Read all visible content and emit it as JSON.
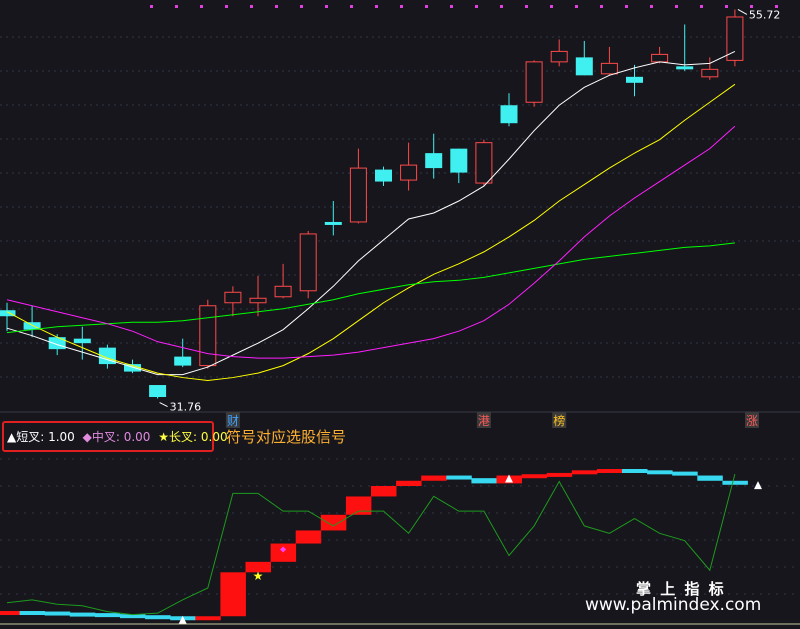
{
  "chart_data": [
    {
      "type": "candlestick",
      "title": "",
      "price_labels": {
        "high": "55.72",
        "low": "31.76"
      },
      "candles": [
        {
          "o": 37.7,
          "c": 37.3,
          "h": 38.2,
          "l": 36.3
        },
        {
          "o": 36.9,
          "c": 36.4,
          "h": 38.0,
          "l": 35.9
        },
        {
          "o": 35.9,
          "c": 35.1,
          "h": 36.1,
          "l": 34.7
        },
        {
          "o": 35.8,
          "c": 35.5,
          "h": 36.6,
          "l": 34.4
        },
        {
          "o": 35.2,
          "c": 34.1,
          "h": 35.4,
          "l": 33.8
        },
        {
          "o": 34.1,
          "c": 33.6,
          "h": 34.4,
          "l": 33.5
        },
        {
          "o": 32.7,
          "c": 31.9,
          "h": 32.7,
          "l": 31.8
        },
        {
          "o": 34.6,
          "c": 34.0,
          "h": 35.8,
          "l": 33.9
        },
        {
          "o": 34.0,
          "c": 38.0,
          "h": 38.4,
          "l": 33.8
        },
        {
          "o": 38.2,
          "c": 38.9,
          "h": 39.3,
          "l": 37.3
        },
        {
          "o": 38.2,
          "c": 38.5,
          "h": 40.0,
          "l": 37.3
        },
        {
          "o": 38.6,
          "c": 39.3,
          "h": 40.8,
          "l": 38.5
        },
        {
          "o": 39.0,
          "c": 42.8,
          "h": 43.0,
          "l": 38.5
        },
        {
          "o": 43.6,
          "c": 43.4,
          "h": 45.0,
          "l": 42.7
        },
        {
          "o": 43.6,
          "c": 47.2,
          "h": 48.5,
          "l": 43.5
        },
        {
          "o": 47.1,
          "c": 46.3,
          "h": 47.3,
          "l": 46.0
        },
        {
          "o": 46.4,
          "c": 47.4,
          "h": 48.9,
          "l": 45.7
        },
        {
          "o": 48.2,
          "c": 47.2,
          "h": 49.5,
          "l": 46.5
        },
        {
          "o": 48.5,
          "c": 46.9,
          "h": 48.5,
          "l": 46.2
        },
        {
          "o": 46.2,
          "c": 48.9,
          "h": 49.1,
          "l": 46.0
        },
        {
          "o": 51.4,
          "c": 50.2,
          "h": 52.2,
          "l": 50.0
        },
        {
          "o": 51.6,
          "c": 54.3,
          "h": 54.4,
          "l": 51.3
        },
        {
          "o": 54.3,
          "c": 55.0,
          "h": 55.8,
          "l": 54.0
        },
        {
          "o": 54.6,
          "c": 53.4,
          "h": 55.7,
          "l": 53.4
        },
        {
          "o": 53.5,
          "c": 54.2,
          "h": 55.3,
          "l": 53.4
        },
        {
          "o": 53.3,
          "c": 52.9,
          "h": 54.1,
          "l": 52.0
        },
        {
          "o": 54.3,
          "c": 54.8,
          "h": 55.3,
          "l": 54.2
        },
        {
          "o": 54.0,
          "c": 53.8,
          "h": 56.8,
          "l": 53.7
        },
        {
          "o": 53.3,
          "c": 53.8,
          "h": 54.6,
          "l": 53.1
        },
        {
          "o": 54.4,
          "c": 57.3,
          "h": 57.8,
          "l": 54.0
        }
      ],
      "ma_lines": [
        {
          "name": "",
          "color": "#ffffff",
          "values": [
            36.5,
            36.0,
            35.4,
            34.9,
            34.4,
            33.9,
            33.4,
            33.4,
            33.9,
            34.7,
            35.5,
            36.4,
            37.8,
            39.3,
            41.0,
            42.4,
            43.8,
            44.2,
            45.0,
            46.0,
            47.8,
            49.7,
            51.4,
            52.6,
            53.4,
            53.9,
            54.3,
            54.1,
            54.2,
            55.0
          ]
        },
        {
          "name": "",
          "color": "#ffff00",
          "values": [
            37.6,
            36.7,
            35.9,
            35.2,
            34.5,
            34.0,
            33.5,
            33.2,
            33.0,
            33.2,
            33.5,
            34.0,
            34.8,
            35.8,
            37.0,
            38.2,
            39.2,
            40.1,
            40.8,
            41.6,
            42.6,
            43.7,
            45.0,
            46.1,
            47.2,
            48.2,
            49.1,
            50.4,
            51.6,
            52.8
          ]
        },
        {
          "name": "",
          "color": "#00ff00",
          "values": [
            36.2,
            36.4,
            36.6,
            36.7,
            36.8,
            36.9,
            36.9,
            37.0,
            37.2,
            37.4,
            37.6,
            37.8,
            38.1,
            38.4,
            38.8,
            39.1,
            39.4,
            39.6,
            39.7,
            39.9,
            40.2,
            40.5,
            40.8,
            41.1,
            41.3,
            41.5,
            41.7,
            41.9,
            42.0,
            42.2
          ]
        },
        {
          "name": "",
          "color": "#ff20ff",
          "values": [
            38.4,
            38.0,
            37.6,
            37.2,
            36.8,
            36.3,
            35.6,
            35.2,
            34.8,
            34.6,
            34.5,
            34.5,
            34.6,
            34.7,
            34.9,
            35.2,
            35.5,
            35.8,
            36.3,
            37.0,
            38.1,
            39.5,
            41.0,
            42.6,
            44.0,
            45.2,
            46.3,
            47.4,
            48.5,
            50.0
          ]
        }
      ],
      "bar_markers": [
        {
          "index": 9,
          "text": "财",
          "color": "#3ea2ff"
        },
        {
          "index": 19,
          "text": "港",
          "color": "#ff5a5a"
        },
        {
          "index": 22,
          "text": "榜",
          "color": "#ffc020"
        },
        {
          "index": 30,
          "text": "涨",
          "color": "#ff5a5a"
        }
      ]
    },
    {
      "type": "indicator",
      "legend": [
        {
          "text": "▲短叉: 1.00",
          "color": "#ffffff"
        },
        {
          "text": "◆中叉: 0.00",
          "color": "#e08ae0"
        },
        {
          "text": "★长叉: 0.00",
          "color": "#ffff40"
        }
      ],
      "annotation": "符号对应选股信号",
      "step_values": [
        -0.8,
        -1.0,
        -1.4,
        -1.6,
        -2.0,
        -2.4,
        -2.8,
        -3.0,
        -2.8,
        14.0,
        18.0,
        25.0,
        30.0,
        36.0,
        43.0,
        47.0,
        49.0,
        51.0,
        50.0,
        48.0,
        51.0,
        51.5,
        52.0,
        53.0,
        53.5,
        53.0,
        52.5,
        51.0,
        49.0,
        48.5
      ],
      "oscillator": [
        -2,
        0,
        -3,
        -4,
        -8,
        -10,
        -9,
        0,
        8,
        72,
        72,
        60,
        60,
        50,
        60,
        60,
        45,
        70,
        60,
        60,
        30,
        50,
        80,
        50,
        45,
        55,
        45,
        40,
        20,
        85
      ],
      "triangle_markers": [
        7,
        20,
        30
      ],
      "diamond_markers": [
        11
      ],
      "star_markers": [
        10
      ]
    }
  ],
  "watermark": {
    "title": "掌 上 指 标",
    "url": "www.palmindex.com"
  }
}
